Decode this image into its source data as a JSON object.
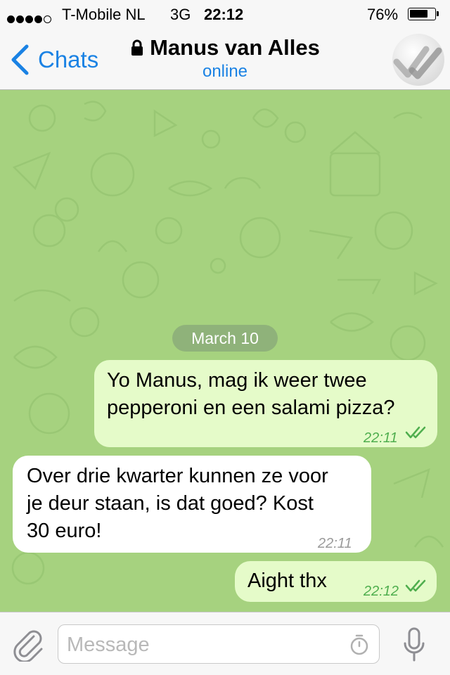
{
  "status_bar": {
    "carrier": "T-Mobile NL",
    "network": "3G",
    "time": "22:12",
    "battery_percent": "76%",
    "battery_level": 0.76,
    "signal_bars": 4,
    "signal_max": 5
  },
  "nav": {
    "back_label": "Chats",
    "title": "Manus van Alles",
    "subtitle": "online",
    "icons": {
      "back": "chevron-left-icon",
      "lock": "lock-icon",
      "avatar": "avatar"
    }
  },
  "chat": {
    "date_separator": "March 10",
    "messages": [
      {
        "direction": "outgoing",
        "lines": [
          "Yo Manus, mag ik weer twee",
          "pepperoni en een salami pizza?"
        ],
        "time": "22:11",
        "read": true
      },
      {
        "direction": "incoming",
        "lines": [
          "Over drie kwarter kunnen ze voor",
          "je deur staan, is dat goed? Kost",
          "30 euro!"
        ],
        "time": "22:11"
      },
      {
        "direction": "outgoing",
        "lines": [
          "Aight thx"
        ],
        "time": "22:12",
        "read": true
      }
    ]
  },
  "composer": {
    "placeholder": "Message",
    "value": "",
    "icons": {
      "attach": "paperclip-icon",
      "timer": "timer-icon",
      "mic": "microphone-icon"
    }
  },
  "colors": {
    "accent": "#1a82e4",
    "chat_background": "#a6d27f",
    "outgoing_bubble": "#e5fbc9",
    "incoming_bubble": "#ffffff",
    "read_checks": "#4fae4e",
    "date_pill": "#8fb27a"
  }
}
